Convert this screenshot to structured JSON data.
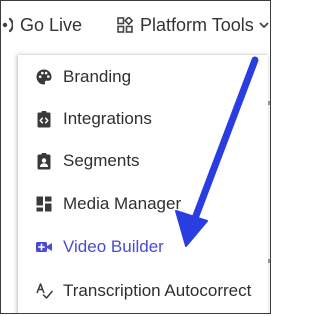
{
  "topbar": {
    "go_live_label": "Go Live",
    "go_live_icon": "broadcast-icon",
    "platform_tools_label": "Platform Tools",
    "platform_tools_icon": "apps-grid-icon",
    "platform_tools_chevron": "chevron-down-icon"
  },
  "menu": {
    "items": [
      {
        "label": "Branding",
        "icon": "palette-icon"
      },
      {
        "label": "Integrations",
        "icon": "code-clipboard-icon"
      },
      {
        "label": "Segments",
        "icon": "contact-badge-icon"
      },
      {
        "label": "Media Manager",
        "icon": "dashboard-grid-icon"
      },
      {
        "label": "Video Builder",
        "icon": "video-camera-plus-icon",
        "active": true
      },
      {
        "label": "Transcription Autocorrect",
        "icon": "spellcheck-icon"
      }
    ]
  },
  "annotation": {
    "arrow_color": "#2a3de0",
    "points_to": "Video Builder"
  },
  "colors": {
    "text": "#2f2f2f",
    "active_text": "#4a4ad6",
    "icon": "#3a3a3a",
    "frame_border": "#3c3c3c"
  }
}
